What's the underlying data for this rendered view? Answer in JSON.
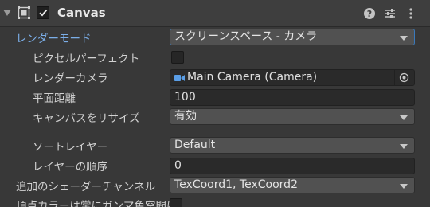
{
  "component": {
    "title": "Canvas",
    "icons": [
      "canvas-component-icon",
      "help-icon",
      "preset-icon",
      "more-icon"
    ]
  },
  "rows": {
    "render_mode": {
      "label": "レンダーモード",
      "value": "スクリーンスペース - カメラ"
    },
    "pixel_perfect": {
      "label": "ピクセルパーフェクト",
      "checked": false
    },
    "render_camera": {
      "label": "レンダーカメラ",
      "value": "Main Camera (Camera)"
    },
    "plane_distance": {
      "label": "平面距離",
      "value": "100"
    },
    "resize_canvas": {
      "label": "キャンバスをリサイズ",
      "value": "有効"
    },
    "sorting_layer": {
      "label": "ソートレイヤー",
      "value": "Default"
    },
    "order_in_layer": {
      "label": "レイヤーの順序",
      "value": "0"
    },
    "additional_shader_channels": {
      "label": "追加のシェーダーチャンネル",
      "value": "TexCoord1, TexCoord2"
    },
    "vertex_color_gamma": {
      "label": "頂点カラーは常にガンマ色空間に",
      "checked": false
    }
  },
  "colors": {
    "active_label": "#7baee8",
    "focus_border": "#3a79bb",
    "camera_icon": "#5a9ee6"
  }
}
